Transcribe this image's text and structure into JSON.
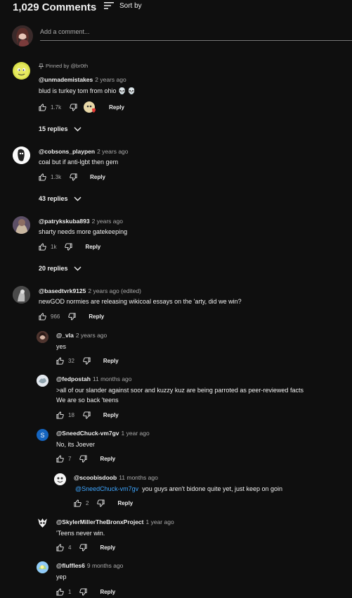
{
  "header": {
    "count": "1,029 Comments",
    "sort_label": "Sort by"
  },
  "add_comment": {
    "placeholder": "Add a comment..."
  },
  "comments": [
    {
      "pinned_by": "Pinned by @br0th",
      "author": "@unmademistakes",
      "time": "2 years ago",
      "text": "blud is turkey tom from ohio 💀 💀",
      "likes": "1.7k",
      "reply": "Reply",
      "replies": "15 replies"
    },
    {
      "author": "@cobsons_playpen",
      "time": "2 years ago",
      "text": "coal but if anti-lgbt then gem",
      "likes": "1.3k",
      "reply": "Reply",
      "replies": "43 replies"
    },
    {
      "author": "@patrykskuba893",
      "time": "2 years ago",
      "text": "sharty needs more gatekeeping",
      "likes": "1k",
      "reply": "Reply",
      "replies": "20 replies"
    },
    {
      "author": "@basedtvrk9125",
      "time": "2 years ago (edited)",
      "text": "newGOD normies are releasing wikicoal essays on the 'arty, did we win?",
      "likes": "966",
      "reply": "Reply"
    }
  ],
  "replies": [
    {
      "author": "@_vla",
      "time": "2 years ago",
      "text": "yes",
      "likes": "32",
      "reply": "Reply"
    },
    {
      "author": "@fedpostah",
      "time": "11 months ago",
      "text_line1": ">all of our slander against soor and kuzzy kuz are being parroted as peer-reviewed facts",
      "text_line2": "We are so back 'teens",
      "likes": "18",
      "reply": "Reply"
    },
    {
      "author": "@SneedChuck-vm7gv",
      "avatar_letter": "S",
      "time": "1 year ago",
      "text": "No, its Joever",
      "likes": "7",
      "reply": "Reply"
    },
    {
      "author": "@scoobisdoob",
      "time": "11 months ago",
      "mention": "@SneedChuck-vm7gv",
      "text": "you guys aren't bidone quite yet, just keep on goin",
      "likes": "2",
      "reply": "Reply"
    },
    {
      "author": "@SkylerMillerTheBronxProject",
      "time": "1 year ago",
      "text": "'Teens never win.",
      "likes": "4",
      "reply": "Reply"
    },
    {
      "author": "@fluffles6",
      "time": "9 months ago",
      "text": "yep",
      "likes": "1",
      "reply": "Reply"
    }
  ],
  "colors": {
    "background": "#0f0f0f",
    "text": "#f1f1f1",
    "secondary": "#aaaaaa",
    "link": "#3ea6ff",
    "avatar_blue": "#1565c0"
  }
}
